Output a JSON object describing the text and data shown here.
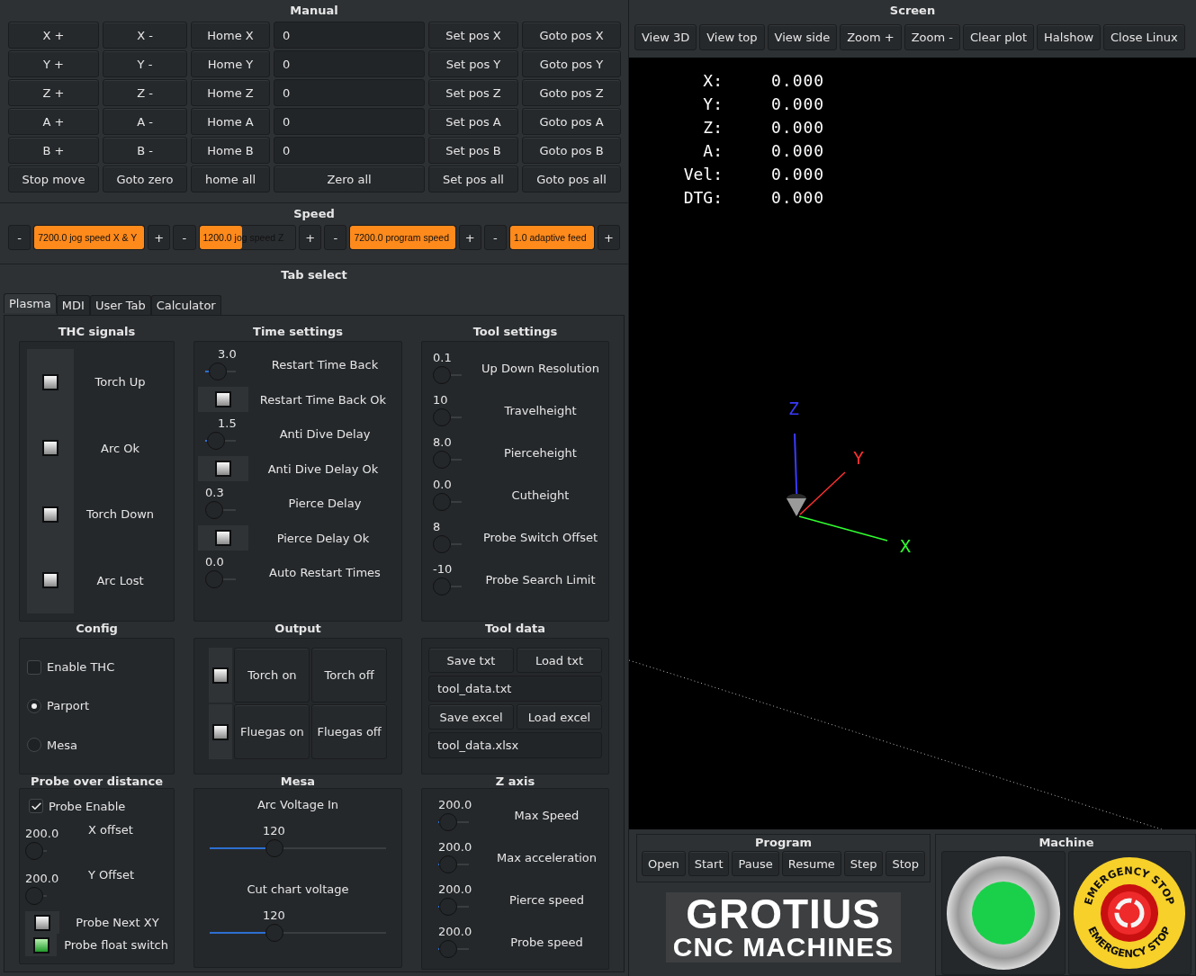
{
  "manual": {
    "title": "Manual",
    "rows": [
      [
        {
          "kind": "button",
          "label": "X +"
        },
        {
          "kind": "button",
          "label": "X -"
        },
        {
          "kind": "button",
          "label": "Home X"
        },
        {
          "kind": "field",
          "value": "0"
        },
        {
          "kind": "button",
          "label": "Set pos X"
        },
        {
          "kind": "button",
          "label": "Goto pos X"
        }
      ],
      [
        {
          "kind": "button",
          "label": "Y +"
        },
        {
          "kind": "button",
          "label": "Y -"
        },
        {
          "kind": "button",
          "label": "Home Y"
        },
        {
          "kind": "field",
          "value": "0"
        },
        {
          "kind": "button",
          "label": "Set pos Y"
        },
        {
          "kind": "button",
          "label": "Goto pos Y"
        }
      ],
      [
        {
          "kind": "button",
          "label": "Z +"
        },
        {
          "kind": "button",
          "label": "Z -"
        },
        {
          "kind": "button",
          "label": "Home Z"
        },
        {
          "kind": "field",
          "value": "0"
        },
        {
          "kind": "button",
          "label": "Set pos Z"
        },
        {
          "kind": "button",
          "label": "Goto pos Z"
        }
      ],
      [
        {
          "kind": "button",
          "label": "A +"
        },
        {
          "kind": "button",
          "label": "A -"
        },
        {
          "kind": "button",
          "label": "Home A"
        },
        {
          "kind": "field",
          "value": "0"
        },
        {
          "kind": "button",
          "label": "Set pos A"
        },
        {
          "kind": "button",
          "label": "Goto pos A"
        }
      ],
      [
        {
          "kind": "button",
          "label": "B +"
        },
        {
          "kind": "button",
          "label": "B -"
        },
        {
          "kind": "button",
          "label": "Home B"
        },
        {
          "kind": "field",
          "value": "0"
        },
        {
          "kind": "button",
          "label": "Set pos B"
        },
        {
          "kind": "button",
          "label": "Goto pos B"
        }
      ],
      [
        {
          "kind": "button",
          "label": "Stop move"
        },
        {
          "kind": "button",
          "label": "Goto zero"
        },
        {
          "kind": "button",
          "label": "home all"
        },
        {
          "kind": "button",
          "label": "Zero all"
        },
        {
          "kind": "button",
          "label": "Set pos all"
        },
        {
          "kind": "button",
          "label": "Goto pos all"
        }
      ]
    ]
  },
  "speed": {
    "title": "Speed",
    "controls": [
      {
        "minus": "-",
        "label": "7200.0 jog speed X & Y",
        "level": 1,
        "plus": "+"
      },
      {
        "minus": "-",
        "label": "1200.0 jog speed Z",
        "level": 0.45,
        "plus": "+"
      },
      {
        "minus": "-",
        "label": "7200.0 program speed",
        "level": 1,
        "plus": "+"
      },
      {
        "minus": "-",
        "label": "1.0 adaptive feed",
        "level": 1,
        "plus": "+"
      }
    ]
  },
  "tab_select": {
    "title": "Tab select",
    "tabs": [
      {
        "label": "Plasma",
        "selected": true
      },
      {
        "label": "MDI",
        "selected": false
      },
      {
        "label": "User Tab",
        "selected": false
      },
      {
        "label": "Calculator",
        "selected": false
      }
    ]
  },
  "thc_signals": {
    "title": "THC signals",
    "items": [
      {
        "label": "Torch Up",
        "on": false
      },
      {
        "label": "Arc Ok",
        "on": false
      },
      {
        "label": "Torch Down",
        "on": false
      },
      {
        "label": "Arc Lost",
        "on": false
      }
    ]
  },
  "time_settings": {
    "title": "Time settings",
    "items": [
      {
        "kind": "slider",
        "value": "3.0",
        "label": "Restart Time Back",
        "level": 0.3
      },
      {
        "kind": "led",
        "label": "Restart Time Back Ok",
        "on": false
      },
      {
        "kind": "slider",
        "value": "1.5",
        "label": "Anti Dive Delay",
        "level": 0.15
      },
      {
        "kind": "led",
        "label": "Anti Dive Delay Ok",
        "on": false
      },
      {
        "kind": "slider",
        "value": "0.3",
        "label": "Pierce Delay",
        "level": 0
      },
      {
        "kind": "led",
        "label": "Pierce Delay Ok",
        "on": false
      },
      {
        "kind": "slider",
        "value": "0.0",
        "label": "Auto Restart Times",
        "level": 0
      }
    ]
  },
  "tool_settings": {
    "title": "Tool settings",
    "items": [
      {
        "value": "0.1",
        "label": "Up Down Resolution",
        "level": 0
      },
      {
        "value": "10",
        "label": "Travelheight",
        "level": 0
      },
      {
        "value": "8.0",
        "label": "Pierceheight",
        "level": 0
      },
      {
        "value": "0.0",
        "label": "Cutheight",
        "level": 0
      },
      {
        "value": "8",
        "label": "Probe Switch Offset",
        "level": 0
      },
      {
        "value": "-10",
        "label": "Probe Search Limit",
        "level": 0
      }
    ]
  },
  "config": {
    "title": "Config",
    "items": [
      {
        "kind": "checkbox",
        "label": "Enable THC",
        "checked": false
      },
      {
        "kind": "radio",
        "label": "Parport",
        "selected": true
      },
      {
        "kind": "radio",
        "label": "Mesa",
        "selected": false
      }
    ]
  },
  "output": {
    "title": "Output",
    "rows": [
      {
        "on": false,
        "buttons": [
          "Torch on",
          "Torch off"
        ]
      },
      {
        "on": false,
        "buttons": [
          "Fluegas on",
          "Fluegas off"
        ]
      }
    ]
  },
  "tool_data": {
    "title": "Tool data",
    "rows": [
      {
        "kind": "buttons",
        "buttons": [
          "Save txt",
          "Load txt"
        ]
      },
      {
        "kind": "field",
        "value": "tool_data.txt"
      },
      {
        "kind": "buttons",
        "buttons": [
          "Save excel",
          "Load excel"
        ]
      },
      {
        "kind": "field",
        "value": "tool_data.xlsx"
      }
    ]
  },
  "probe": {
    "title": "Probe over distance",
    "items": [
      {
        "kind": "checkbox",
        "label": "Probe Enable",
        "checked": true
      },
      {
        "kind": "slider",
        "value": "200.0",
        "label": "X offset",
        "level": 0
      },
      {
        "kind": "slider",
        "value": "200.0",
        "label": "Y Offset",
        "level": 0
      },
      {
        "kind": "led",
        "label": "Probe Next XY",
        "on": false
      },
      {
        "kind": "led",
        "label": "Probe float switch",
        "on": true
      }
    ]
  },
  "mesa": {
    "title": "Mesa",
    "items": [
      {
        "caption": "Arc Voltage In",
        "value": "120",
        "level": 0.35
      },
      {
        "caption": "Cut chart voltage",
        "value": "120",
        "level": 0.35
      }
    ]
  },
  "z_axis": {
    "title": "Z axis",
    "items": [
      {
        "value": "200.0",
        "label": "Max Speed",
        "level": 0.05
      },
      {
        "value": "200.0",
        "label": "Max acceleration",
        "level": 0.05
      },
      {
        "value": "200.0",
        "label": "Pierce speed",
        "level": 0.05
      },
      {
        "value": "200.0",
        "label": "Probe speed",
        "level": 0.05
      }
    ]
  },
  "screen": {
    "title": "Screen",
    "toolbar": [
      "View 3D",
      "View top",
      "View side",
      "Zoom +",
      "Zoom -",
      "Clear plot",
      "Halshow",
      "Close Linux"
    ],
    "dro": [
      {
        "label": "X:",
        "value": "0.000"
      },
      {
        "label": "Y:",
        "value": "0.000"
      },
      {
        "label": "Z:",
        "value": "0.000"
      },
      {
        "label": "A:",
        "value": "0.000"
      },
      {
        "label": "Vel:",
        "value": "0.000"
      },
      {
        "label": "DTG:",
        "value": "0.000"
      }
    ],
    "axis_labels": [
      "Z",
      "Y",
      "X"
    ]
  },
  "program": {
    "title": "Program",
    "buttons": [
      "Open",
      "Start",
      "Pause",
      "Resume",
      "Step",
      "Stop"
    ],
    "logo": [
      "GROTIUS",
      "CNC MACHINES"
    ]
  },
  "machine": {
    "title": "Machine",
    "estop_text": [
      "EMERGENCY STOP",
      "EMERGENCY STOP"
    ]
  }
}
